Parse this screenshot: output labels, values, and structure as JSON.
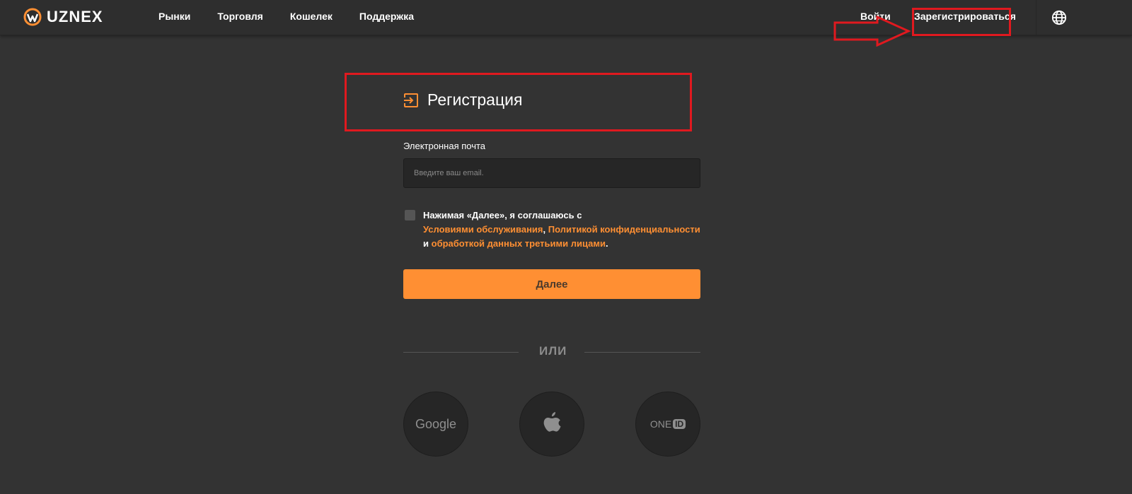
{
  "header": {
    "logo_text": "UZNEX",
    "nav": [
      {
        "label": "Рынки"
      },
      {
        "label": "Торговля"
      },
      {
        "label": "Кошелек"
      },
      {
        "label": "Поддержка"
      }
    ],
    "login_label": "Войти",
    "register_label": "Зарегистрироваться",
    "language_icon": "globe-icon"
  },
  "form": {
    "title": "Регистрация",
    "title_icon": "sign-in-icon",
    "email_label": "Электронная почта",
    "email_placeholder": "Введите ваш email.",
    "email_value": "",
    "agree_checked": false,
    "agree_prefix": "Нажимая «Далее», я соглашаюсь с",
    "terms_link": "Условиями обслуживания",
    "comma": ",",
    "privacy_link": "Политикой конфиденциальности",
    "and": "и",
    "third_party_link": "обработкой данных третьими лицами",
    "period": ".",
    "next_label": "Далее",
    "or_label": "ИЛИ",
    "social": [
      {
        "name": "Google",
        "icon": "google-icon"
      },
      {
        "name": "Apple",
        "icon": "apple-icon"
      },
      {
        "name": "ONE ID",
        "icon": "oneid-icon"
      }
    ]
  },
  "oneid": {
    "one": "ONE",
    "id": "ID"
  },
  "colors": {
    "accent": "#ff8f33",
    "background": "#333333",
    "header": "#2e2e2e",
    "annotation": "#e0191f"
  }
}
